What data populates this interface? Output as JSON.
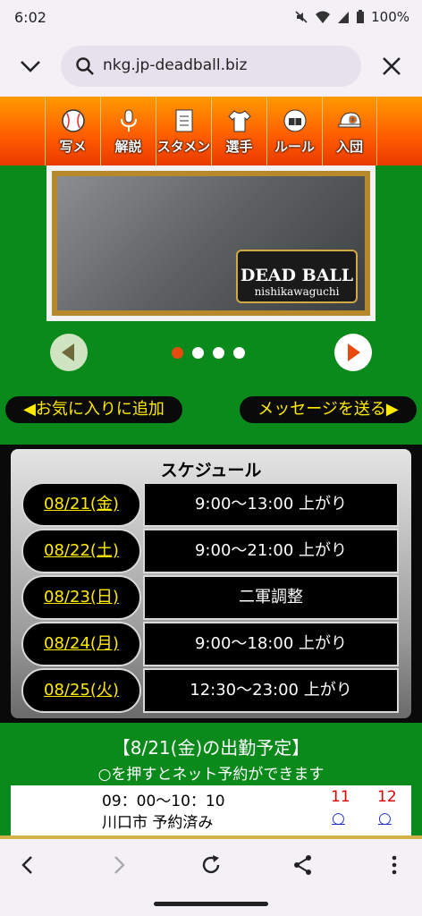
{
  "status": {
    "time": "6:02",
    "battery": "100%"
  },
  "browser": {
    "url": "nkg.jp-deadball.biz"
  },
  "nav": [
    {
      "label": "写メ",
      "icon": "baseball-icon"
    },
    {
      "label": "解説",
      "icon": "microphone-icon"
    },
    {
      "label": "スタメン",
      "icon": "document-icon"
    },
    {
      "label": "選手",
      "icon": "jersey-icon"
    },
    {
      "label": "ルール",
      "icon": "catcher-mask-icon"
    },
    {
      "label": "入団",
      "icon": "cap-icon"
    }
  ],
  "banner": {
    "logo_title": "DEAD BALL",
    "logo_sub": "nishikawaguchi",
    "slide_count": 4,
    "active_slide": 1
  },
  "actions": {
    "favorite": "◀お気に入りに追加",
    "message": "メッセージを送る▶"
  },
  "schedule": {
    "title": "スケジュール",
    "rows": [
      {
        "date": "08/21(金)",
        "value": "9:00〜13:00 上がり"
      },
      {
        "date": "08/22(土)",
        "value": "9:00〜21:00 上がり"
      },
      {
        "date": "08/23(日)",
        "value": "二軍調整"
      },
      {
        "date": "08/24(月)",
        "value": "9:00〜18:00 上がり"
      },
      {
        "date": "08/25(火)",
        "value": "12:30〜23:00 上がり"
      }
    ]
  },
  "attendance": {
    "title": "【8/21(金)の出勤予定】",
    "subtitle": "○を押すとネット予約ができます",
    "time_range": "09：00〜10：10",
    "location": "川口市 予約済み",
    "col11": "11",
    "col12": "12",
    "mark11": "○",
    "mark12": "○"
  },
  "colors": {
    "nav_orange": "#ff5a00",
    "green": "#0a8a1a",
    "accent_yellow": "#ffeb00",
    "dot_active": "#e84a10"
  }
}
